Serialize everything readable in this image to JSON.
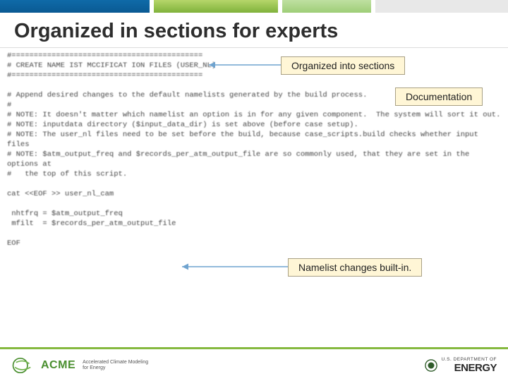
{
  "slide": {
    "title": "Organized in sections for experts"
  },
  "code": {
    "block": "#===========================================\n# CREATE NAME IST MCCIFICAT ION FILES (USER_NL)\n#===========================================\n\n# Append desired changes to the default namelists generated by the build process.\n#\n# NOTE: It doesn't matter which namelist an option is in for any given component.  The system will sort it out.\n# NOTE: inputdata directory ($input_data_dir) is set above (before case setup).\n# NOTE: The user_nl files need to be set before the build, because case_scripts.build checks whether input files\n# NOTE: $atm_output_freq and $records_per_atm_output_file are so commonly used, that they are set in the options at\n#   the top of this script.\n\ncat <<EOF >> user_nl_cam\n\n nhtfrq = $atm_output_freq\n mfilt  = $records_per_atm_output_file\n\nEOF"
  },
  "callouts": {
    "c1": "Organized into sections",
    "c2": "Documentation",
    "c3": "Namelist changes built-in."
  },
  "footer": {
    "acme": "ACME",
    "acme_sub1": "Accelerated Climate Modeling",
    "acme_sub2": "for Energy",
    "doe_top": "U.S. DEPARTMENT OF",
    "doe_main": "ENERGY"
  }
}
